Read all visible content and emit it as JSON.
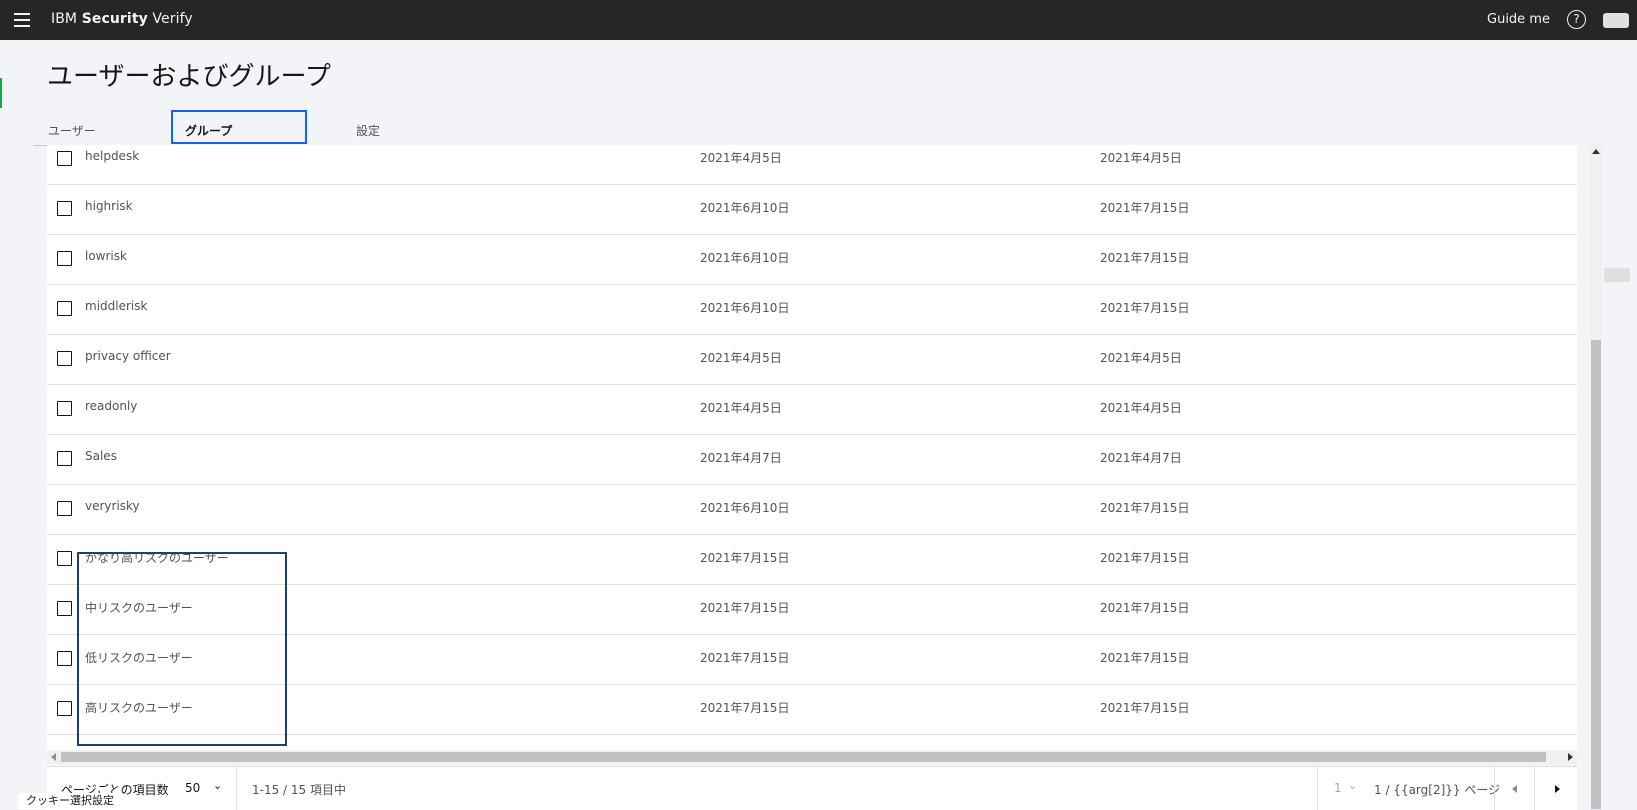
{
  "header": {
    "brand_prefix": "IBM",
    "brand_bold": "Security",
    "brand_suffix": "Verify",
    "guide_label": "Guide me",
    "help_glyph": "?"
  },
  "page": {
    "title": "ユーザーおよびグループ"
  },
  "tabs": [
    {
      "label": "ユーザー",
      "selected": false
    },
    {
      "label": "グループ",
      "selected": true
    },
    {
      "label": "設定",
      "selected": false
    }
  ],
  "rows": [
    {
      "name": "helpdesk",
      "created": "2021年4月5日",
      "modified": "2021年4月5日"
    },
    {
      "name": "highrisk",
      "created": "2021年6月10日",
      "modified": "2021年7月15日"
    },
    {
      "name": "lowrisk",
      "created": "2021年6月10日",
      "modified": "2021年7月15日"
    },
    {
      "name": "middlerisk",
      "created": "2021年6月10日",
      "modified": "2021年7月15日"
    },
    {
      "name": "privacy officer",
      "created": "2021年4月5日",
      "modified": "2021年4月5日"
    },
    {
      "name": "readonly",
      "created": "2021年4月5日",
      "modified": "2021年4月5日"
    },
    {
      "name": "Sales",
      "created": "2021年4月7日",
      "modified": "2021年4月7日"
    },
    {
      "name": "veryrisky",
      "created": "2021年6月10日",
      "modified": "2021年7月15日"
    },
    {
      "name": "かなり高リスクのユーザー",
      "created": "2021年7月15日",
      "modified": "2021年7月15日"
    },
    {
      "name": "中リスクのユーザー",
      "created": "2021年7月15日",
      "modified": "2021年7月15日"
    },
    {
      "name": "低リスクのユーザー",
      "created": "2021年7月15日",
      "modified": "2021年7月15日"
    },
    {
      "name": "高リスクのユーザー",
      "created": "2021年7月15日",
      "modified": "2021年7月15日"
    }
  ],
  "pagination": {
    "items_per_page_label": "ページごとの項目数",
    "items_per_page_value": "50",
    "range_text": "1-15 / 15 項目中",
    "current_page": "1",
    "page_of_text": "1 / {{arg[2]}} ページ"
  },
  "cookie_label": "クッキー選択設定",
  "colors": {
    "topbar": "#262626",
    "accent": "#0f62fe",
    "highlight_box": "#1f3f76"
  },
  "icons": [
    "menu-icon",
    "help-icon",
    "chevron-down-icon",
    "caret-left-icon",
    "caret-right-icon"
  ]
}
